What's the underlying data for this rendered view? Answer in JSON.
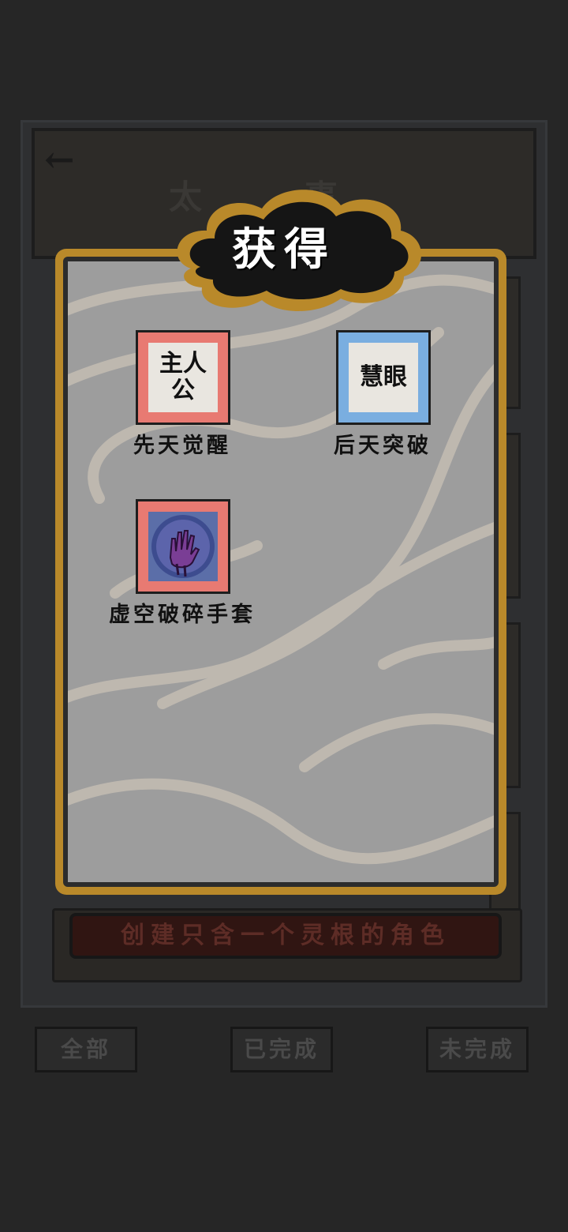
{
  "background": {
    "title": "太",
    "title_tail": "事",
    "task_text": "创建只含一个灵根的角色",
    "tabs": [
      "全部",
      "已完成",
      "未完成"
    ]
  },
  "popup": {
    "title": "获得",
    "items": [
      {
        "tile_text": "主人公",
        "label": "先天觉醒",
        "tile_color": "#e87a72"
      },
      {
        "tile_text": "慧眼",
        "label": "后天突破",
        "tile_color": "#7aaee0"
      },
      {
        "tile_icon": "void-gauntlet-icon",
        "label": "虚空破碎手套",
        "tile_color": "#e87a72"
      }
    ]
  }
}
